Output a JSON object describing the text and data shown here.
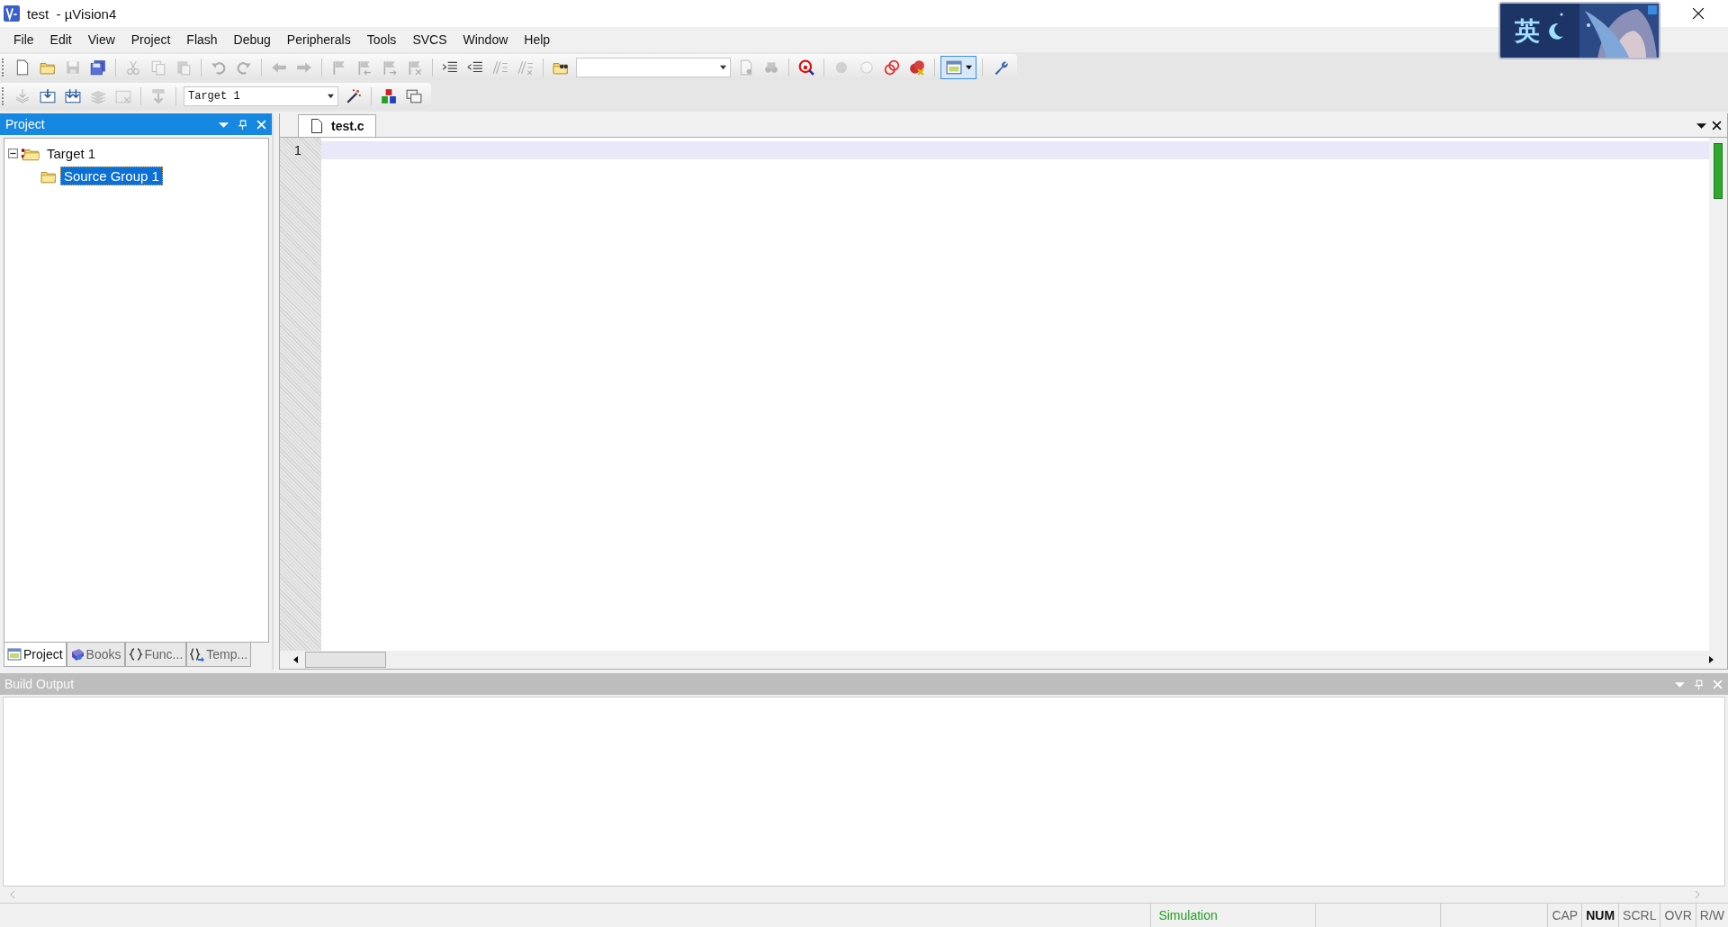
{
  "window": {
    "title": "test  - µVision4"
  },
  "ime_widget": {
    "label": "英"
  },
  "menu": [
    "File",
    "Edit",
    "View",
    "Project",
    "Flash",
    "Debug",
    "Peripherals",
    "Tools",
    "SVCS",
    "Window",
    "Help"
  ],
  "toolbars": [
    {
      "items": [
        {
          "kind": "button",
          "disabled": false
        },
        {
          "kind": "button",
          "disabled": false
        },
        {
          "kind": "button",
          "disabled": true
        },
        {
          "kind": "button",
          "disabled": false
        },
        {
          "kind": "separator"
        },
        {
          "kind": "button",
          "disabled": true
        },
        {
          "kind": "button",
          "disabled": true
        },
        {
          "kind": "button",
          "disabled": true
        },
        {
          "kind": "separator"
        },
        {
          "kind": "button",
          "disabled": true
        },
        {
          "kind": "button",
          "disabled": true
        },
        {
          "kind": "separator"
        },
        {
          "kind": "button",
          "disabled": true
        },
        {
          "kind": "button",
          "disabled": true
        },
        {
          "kind": "separator"
        },
        {
          "kind": "button",
          "disabled": true
        },
        {
          "kind": "button",
          "disabled": true
        },
        {
          "kind": "button",
          "disabled": true
        },
        {
          "kind": "button",
          "disabled": true
        },
        {
          "kind": "separator"
        },
        {
          "kind": "button",
          "disabled": false
        },
        {
          "kind": "button",
          "disabled": false
        },
        {
          "kind": "button",
          "disabled": true
        },
        {
          "kind": "button",
          "disabled": true
        },
        {
          "kind": "separator"
        },
        {
          "kind": "button",
          "disabled": false
        },
        {
          "kind": "combo"
        },
        {
          "kind": "button",
          "disabled": true
        },
        {
          "kind": "button",
          "disabled": true
        },
        {
          "kind": "separator"
        },
        {
          "kind": "button",
          "disabled": false
        },
        {
          "kind": "separator"
        },
        {
          "kind": "button",
          "disabled": true
        },
        {
          "kind": "button",
          "disabled": true
        },
        {
          "kind": "button",
          "disabled": false
        },
        {
          "kind": "button",
          "disabled": false
        },
        {
          "kind": "separator"
        },
        {
          "kind": "split",
          "pressed": true
        },
        {
          "kind": "separator"
        },
        {
          "kind": "button",
          "disabled": false
        }
      ]
    },
    {
      "items": [
        {
          "kind": "button",
          "disabled": true
        },
        {
          "kind": "button",
          "disabled": false
        },
        {
          "kind": "button",
          "disabled": false
        },
        {
          "kind": "button",
          "disabled": true
        },
        {
          "kind": "button",
          "disabled": true
        },
        {
          "kind": "separator"
        },
        {
          "kind": "button",
          "disabled": true
        },
        {
          "kind": "separator"
        },
        {
          "kind": "combo",
          "value": "Target 1"
        },
        {
          "kind": "button",
          "disabled": false
        },
        {
          "kind": "separator"
        },
        {
          "kind": "button",
          "disabled": false
        },
        {
          "kind": "button",
          "disabled": false
        }
      ]
    }
  ],
  "project_panel": {
    "title": "Project",
    "tree": [
      {
        "label": "Target 1",
        "expanded": true,
        "selected": false,
        "children": [
          {
            "label": "Source Group 1",
            "selected": false,
            "highlighted": true
          }
        ]
      }
    ],
    "tabs": [
      {
        "label": "Project",
        "selected": true
      },
      {
        "label": "Books",
        "selected": false
      },
      {
        "label": "Func...",
        "selected": false
      },
      {
        "label": "Temp...",
        "selected": false
      }
    ]
  },
  "editor": {
    "tabs": [
      {
        "label": "test.c",
        "selected": true
      }
    ],
    "line_numbers": [
      "1"
    ]
  },
  "build_output": {
    "title": "Build Output"
  },
  "status_bar": {
    "mode": "Simulation",
    "indicators": [
      {
        "label": "CAP",
        "active": false
      },
      {
        "label": "NUM",
        "active": true
      },
      {
        "label": "SCRL",
        "active": false
      },
      {
        "label": "OVR",
        "active": false
      },
      {
        "label": "R/W",
        "active": false
      }
    ]
  }
}
